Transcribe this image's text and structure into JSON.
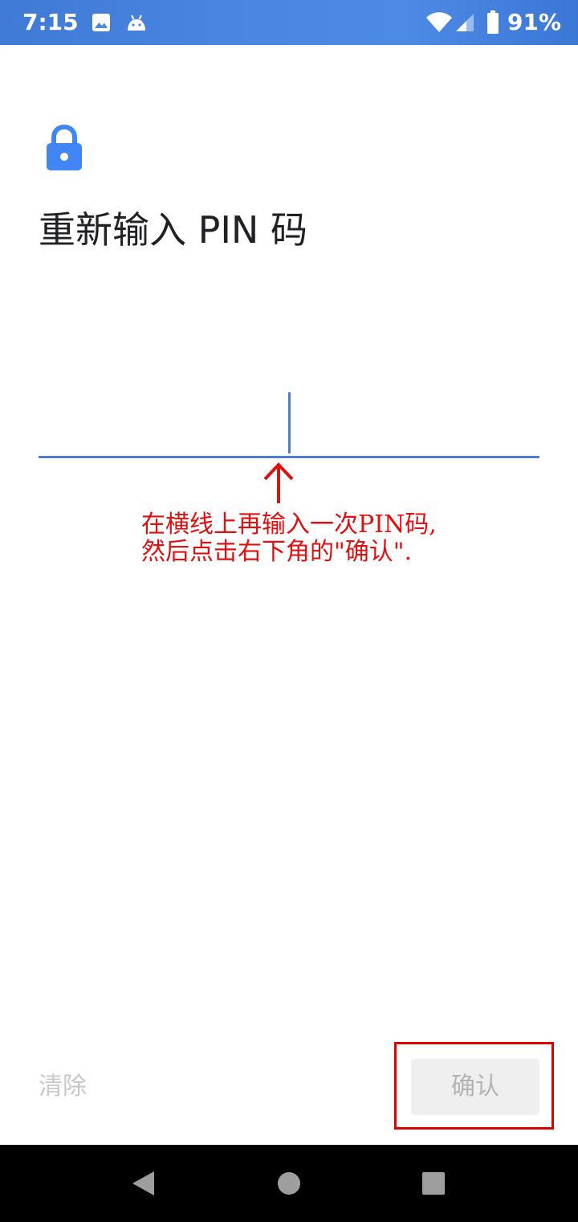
{
  "status_bar": {
    "time": "7:15",
    "battery_percent": "91%",
    "icons": [
      "image-icon",
      "android-icon",
      "wifi-icon",
      "signal-icon",
      "battery-icon"
    ]
  },
  "screen": {
    "lock_icon": "lock-icon",
    "title": "重新输入 PIN 码"
  },
  "annotation": {
    "arrow_icon": "arrow-up-icon",
    "line1": "在横线上再输入一次PIN码,",
    "line2": "然后点击右下角的\"确认\"."
  },
  "actions": {
    "clear_label": "清除",
    "confirm_label": "确认"
  },
  "nav_bar": {
    "icons": [
      "back-icon",
      "home-icon",
      "recents-icon"
    ]
  },
  "colors": {
    "accent": "#4a7fd1",
    "status_bar": "#4a86e2",
    "annotation": "#e01010",
    "disabled_text": "#c8c8c8"
  }
}
